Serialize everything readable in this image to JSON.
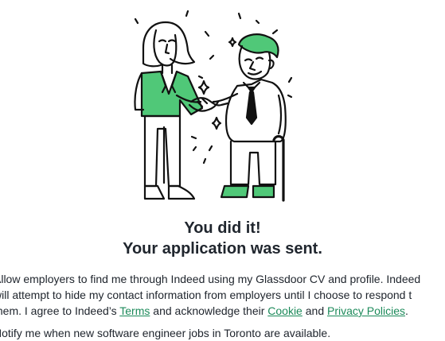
{
  "colors": {
    "accent": "#50c878",
    "link": "#1c8a5a",
    "ink": "#20262e"
  },
  "hero": {
    "illustration": "handshake-illustration"
  },
  "confirmation": {
    "title_line1": "You did it!",
    "title_line2": "Your application was sent."
  },
  "consent": {
    "line1": "Allow employers to find me through Indeed using my Glassdoor CV and profile. Indeed",
    "line2": "will attempt to hide my contact information from employers until I choose to respond t",
    "line3_prefix": "them. I agree to Indeed’s ",
    "terms_link": "Terms",
    "middle_text": " and acknowledge their ",
    "cookie_link": "Cookie",
    "and_text": " and ",
    "privacy_link": "Privacy Policies",
    "end_text": "."
  },
  "notify": {
    "text": "Notify me when new software engineer jobs in Toronto are available."
  }
}
